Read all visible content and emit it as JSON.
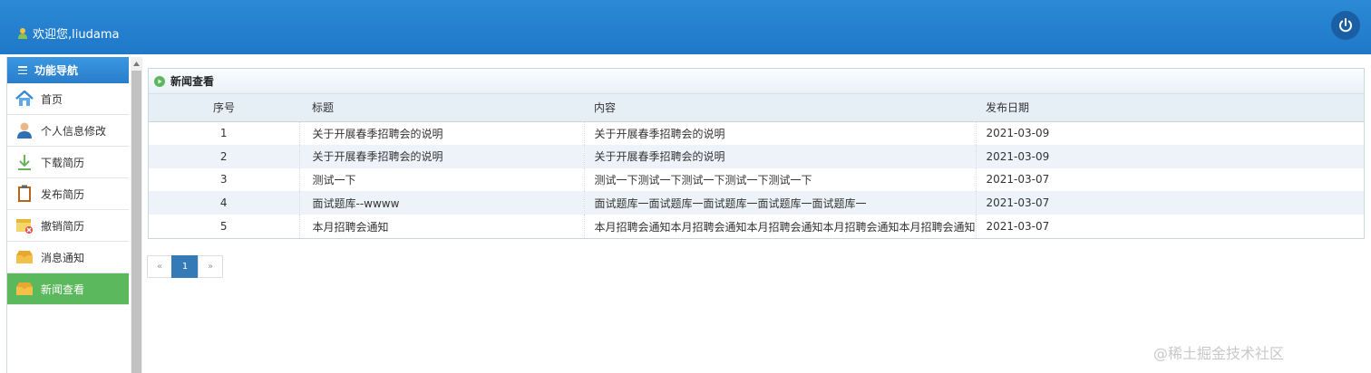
{
  "header": {
    "welcome_text": "欢迎您,liudama",
    "icons": {
      "user": "user-icon",
      "power": "power-icon"
    },
    "colors": {
      "bar": "#1f78c8",
      "power_bg": "#1a5fa3"
    }
  },
  "sidebar": {
    "title": "功能导航",
    "items": [
      {
        "label": "首页",
        "icon": "home-icon",
        "active": false
      },
      {
        "label": "个人信息修改",
        "icon": "person-icon",
        "active": false
      },
      {
        "label": "下载简历",
        "icon": "download-icon",
        "active": false
      },
      {
        "label": "发布简历",
        "icon": "clipboard-icon",
        "active": false
      },
      {
        "label": "撤销简历",
        "icon": "revoke-icon",
        "active": false
      },
      {
        "label": "消息通知",
        "icon": "inbox-icon",
        "active": false
      },
      {
        "label": "新闻查看",
        "icon": "inbox-icon",
        "active": true
      }
    ],
    "active_color": "#5cb85c"
  },
  "panel": {
    "title": "新闻查看",
    "columns": [
      "序号",
      "标题",
      "内容",
      "发布日期"
    ],
    "rows": [
      {
        "idx": "1",
        "title": "关于开展春季招聘会的说明",
        "content": "关于开展春季招聘会的说明",
        "date": "2021-03-09"
      },
      {
        "idx": "2",
        "title": "关于开展春季招聘会的说明",
        "content": "关于开展春季招聘会的说明",
        "date": "2021-03-09"
      },
      {
        "idx": "3",
        "title": "测试一下",
        "content": "测试一下测试一下测试一下测试一下测试一下",
        "date": "2021-03-07"
      },
      {
        "idx": "4",
        "title": "面试题库--wwww",
        "content": "面试题库一面试题库一面试题库一面试题库一面试题库一",
        "date": "2021-03-07"
      },
      {
        "idx": "5",
        "title": "本月招聘会通知",
        "content": "本月招聘会通知本月招聘会通知本月招聘会通知本月招聘会通知本月招聘会通知",
        "date": "2021-03-07"
      }
    ]
  },
  "pagination": {
    "prev": "«",
    "current": "1",
    "next": "»"
  },
  "watermark": "@稀土掘金技术社区"
}
